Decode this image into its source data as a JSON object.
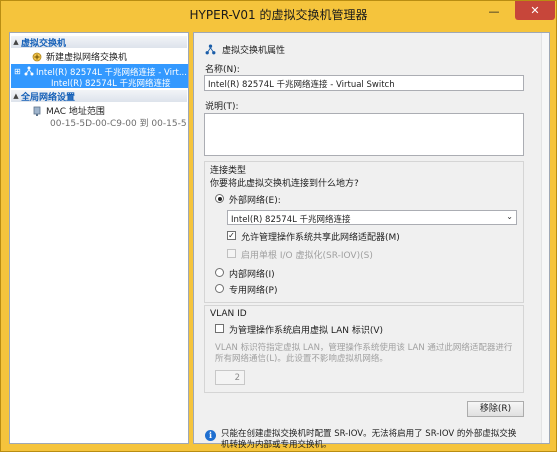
{
  "window": {
    "title": "HYPER-V01 的虚拟交换机管理器",
    "minimize": "—",
    "maximize": "□",
    "close": "✕"
  },
  "left": {
    "section_switches": "虚拟交换机",
    "new_switch": "新建虚拟网络交换机",
    "switch_line1": "Intel(R) 82574L 千兆网络连接 - Virt...",
    "switch_line2": "Intel(R) 82574L 千兆网络连接",
    "section_global": "全局网络设置",
    "mac_label": "MAC 地址范围",
    "mac_range": "00-15-5D-00-C9-00 到 00-15-5D-0..."
  },
  "right": {
    "props_title": "虚拟交换机属性",
    "name_label": "名称(N):",
    "name_value": "Intel(R) 82574L 千兆网络连接 - Virtual Switch",
    "notes_label": "说明(T):",
    "notes_value": "",
    "conn_type_label": "连接类型",
    "conn_question": "你要将此虚拟交换机连接到什么地方?",
    "external_label": "外部网络(E):",
    "external_adapter": "Intel(R) 82574L 千兆网络连接",
    "allow_mgmt": "允许管理操作系统共享此网络适配器(M)",
    "sriov": "启用单根 I/O 虚拟化(SR-IOV)(S)",
    "internal_label": "内部网络(I)",
    "private_label": "专用网络(P)",
    "vlan_label": "VLAN ID",
    "vlan_check": "为管理操作系统启用虚拟 LAN 标识(V)",
    "vlan_desc": "VLAN 标识符指定虚拟 LAN，管理操作系统使用该 LAN 通过此网络适配器进行所有网络通信(L)。此设置不影响虚拟机网络。",
    "vlan_value": "2",
    "remove_button": "移除(R)",
    "info_text": "只能在创建虚拟交换机时配置 SR-IOV。无法将启用了 SR-IOV 的外部虚拟交换机转换为内部或专用交换机。"
  },
  "colors": {
    "title_bar": "#f5c43c",
    "selection": "#3399ff",
    "section_text": "#1560b8",
    "close_button": "#c7463a"
  }
}
